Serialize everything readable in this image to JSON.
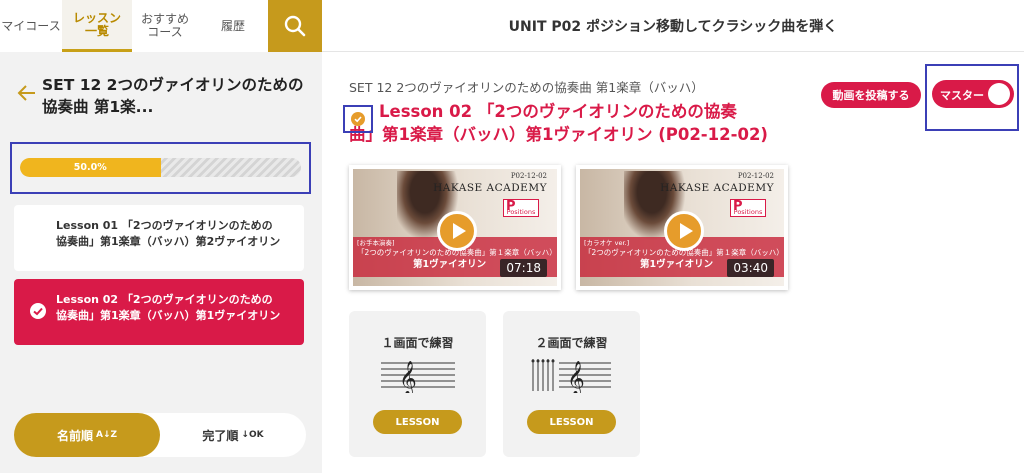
{
  "nav": {
    "tab_mycourse": "マイコース",
    "tab_lessons_l1": "レッスン",
    "tab_lessons_l2": "一覧",
    "tab_recommend_l1": "おすすめ",
    "tab_recommend_l2": "コース",
    "tab_history": "履歴",
    "search_icon": "search-icon"
  },
  "header": {
    "unit_title": "UNIT P02 ポジション移動してクラシック曲を弾く"
  },
  "sidebar": {
    "set_title": "SET 12 2つのヴァイオリンのための協奏曲 第1楽...",
    "progress": {
      "label": "50.0%",
      "value": 50.0
    },
    "lessons": [
      {
        "line1": "Lesson 01 「2つのヴァイオリンのための",
        "line2": "協奏曲」第1楽章（バッハ）第2ヴァイオリン",
        "completed": false
      },
      {
        "line1": "Lesson 02 「2つのヴァイオリンのための",
        "line2": "協奏曲」第1楽章（バッハ）第1ヴァイオリン",
        "completed": true
      }
    ],
    "sort": {
      "by_name": "名前順",
      "by_name_icon": "A↓Z",
      "by_done": "完了順",
      "by_done_icon": "↓OK"
    }
  },
  "main": {
    "breadcrumb": "SET 12 2つのヴァイオリンのための協奏曲 第1楽章（バッハ）",
    "lesson_title_l1": "Lesson 02 「2つのヴァイオリンのための協奏",
    "lesson_title_l2": "曲」第1楽章（バッハ）第1ヴァイオリン (P02-12-02)",
    "post_button": "動画を投稿する",
    "master_toggle": {
      "label": "マスター",
      "on": true
    },
    "videos": [
      {
        "code": "P02-12-02",
        "academy": "HAKASE ACADEMY",
        "logo": "Positions",
        "tag": "[お手本演奏]",
        "caption": "「2つのヴァイオリンのための協奏曲」第１楽章（バッハ）",
        "part": "第1ヴァイオリン",
        "duration": "07:18"
      },
      {
        "code": "P02-12-02",
        "academy": "HAKASE ACADEMY",
        "logo": "Positions",
        "tag": "[カラオケ ver.]",
        "caption": "「2つのヴァイオリンのための協奏曲」第１楽章（バッハ）",
        "part": "第1ヴァイオリン",
        "duration": "03:40"
      }
    ],
    "practice": [
      {
        "title": "１画面で練習",
        "button": "LESSON"
      },
      {
        "title": "２画面で練習",
        "button": "LESSON"
      }
    ]
  },
  "colors": {
    "gold": "#c69a1c",
    "crimson": "#d91a48",
    "progress": "#f0b51e",
    "check": "#e69c2b"
  }
}
